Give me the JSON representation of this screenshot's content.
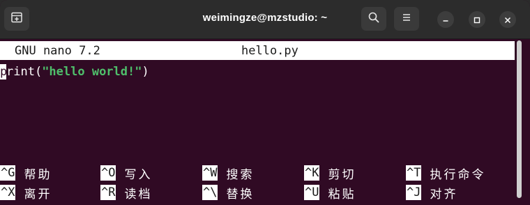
{
  "window": {
    "title": "weimingze@mzstudio: ~"
  },
  "titlebar": {
    "icons": {
      "new_tab": "new-tab-icon",
      "search": "search-icon",
      "menu": "hamburger-menu-icon",
      "minimize": "minimize-icon",
      "maximize": "maximize-icon",
      "close": "close-icon"
    }
  },
  "nano": {
    "version": "GNU nano 7.2",
    "filename": "hello.py",
    "code": {
      "cursor_char": "p",
      "prefix": "rint(",
      "string": "\"hello world!\"",
      "suffix": ")"
    },
    "shortcuts_row1": [
      {
        "key": "^G",
        "label": "帮助"
      },
      {
        "key": "^O",
        "label": "写入"
      },
      {
        "key": "^W",
        "label": "搜索"
      },
      {
        "key": "^K",
        "label": "剪切"
      },
      {
        "key": "^T",
        "label": "执行命令"
      }
    ],
    "shortcuts_row2": [
      {
        "key": "^X",
        "label": "离开"
      },
      {
        "key": "^R",
        "label": "读档"
      },
      {
        "key": "^\\",
        "label": "替换"
      },
      {
        "key": "^U",
        "label": "粘贴"
      },
      {
        "key": "^J",
        "label": "对齐"
      }
    ]
  },
  "colors": {
    "terminal_bg": "#300a24",
    "titlebar_bg": "#2c2c2c",
    "string_green": "#4fbf6b"
  }
}
